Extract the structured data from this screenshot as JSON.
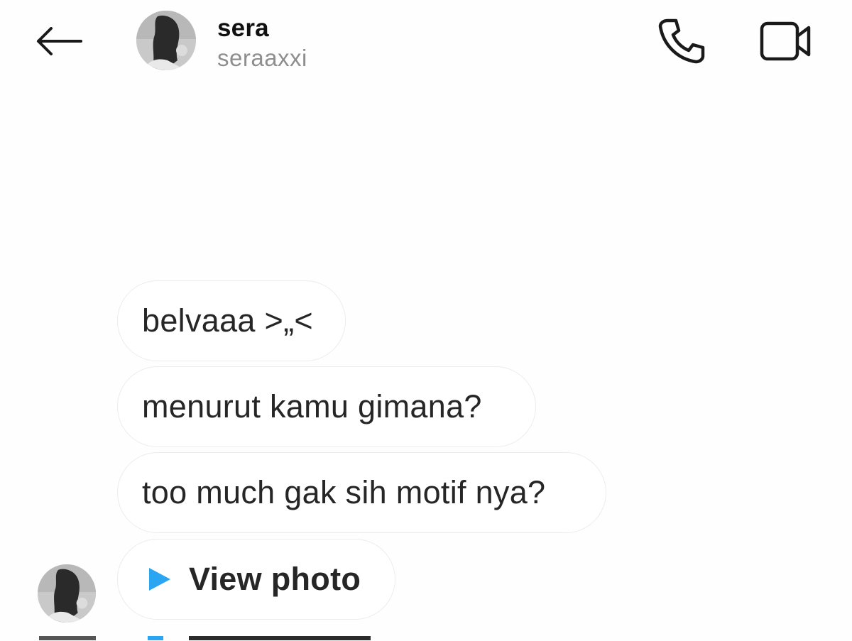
{
  "header": {
    "display_name": "sera",
    "username": "seraaxxi",
    "back_icon": "arrow-left-icon",
    "call_icon": "phone-icon",
    "video_icon": "video-camera-icon"
  },
  "messages": [
    {
      "text": "belvaaa >„<"
    },
    {
      "text": "menurut kamu gimana?"
    },
    {
      "text": "too much gak sih motif nya?"
    },
    {
      "text": "View photo",
      "icon": "play-icon",
      "icon_color": "#2aa5f1"
    }
  ],
  "colors": {
    "accent": "#2aa5f1",
    "username": "#8e8e8e",
    "text": "#262626"
  }
}
